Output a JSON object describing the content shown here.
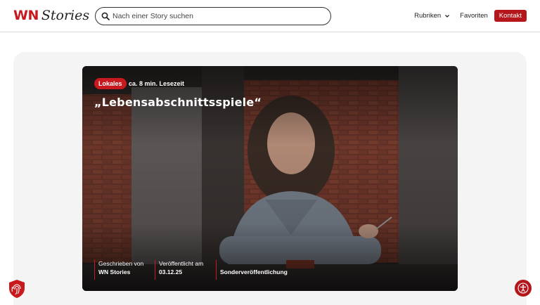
{
  "header": {
    "logo_wn": "WN",
    "logo_stories": "Stories",
    "search_placeholder": "Nach einer Story suchen",
    "nav": {
      "rubriken": "Rubriken",
      "favoriten": "Favoriten",
      "kontakt": "Kontakt"
    }
  },
  "hero": {
    "badge": "Lokales",
    "read_time": "ca. 8 min. Lesezeit",
    "title": "„Lebensabschnittsspiele“",
    "meta": [
      {
        "label": "Geschrieben von",
        "value": "WN Stories"
      },
      {
        "label": "Veröffentlicht am",
        "value": "03.12.25"
      },
      {
        "label": "",
        "value": "Sonderveröffentlichung"
      }
    ]
  },
  "colors": {
    "brand_red": "#c8191f",
    "button_red": "#b5161b",
    "stage_bg": "#f4f4f4"
  },
  "icons": {
    "search": "search-icon",
    "chevron": "chevron-down-icon",
    "shield": "fingerprint-shield-icon",
    "accessibility": "accessibility-icon"
  }
}
